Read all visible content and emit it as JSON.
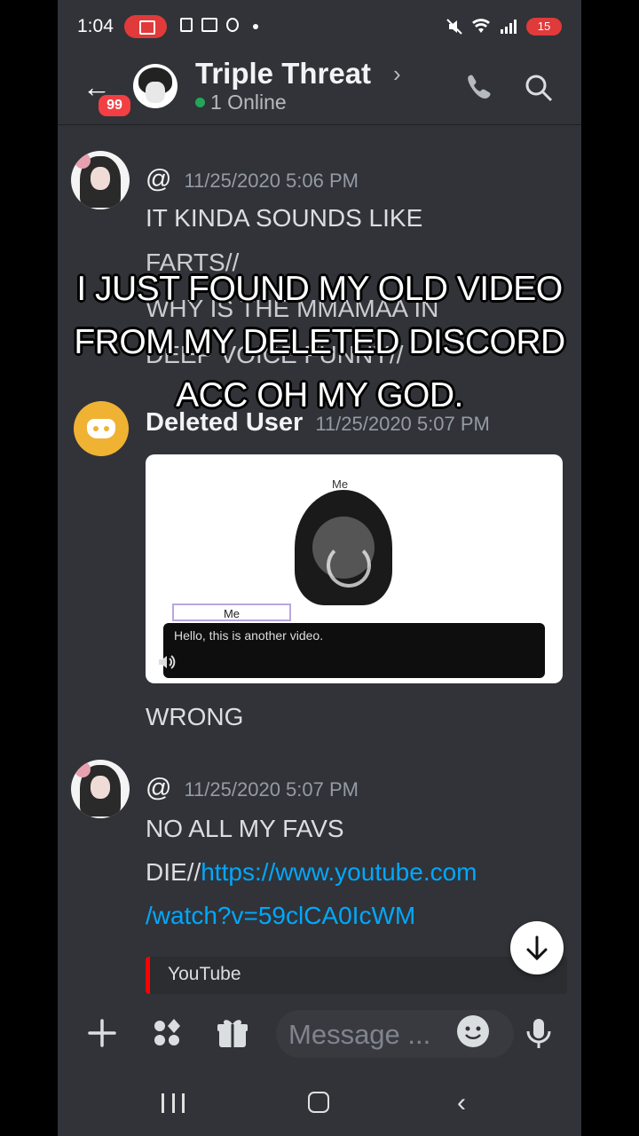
{
  "status_bar": {
    "time": "1:04",
    "battery": "15"
  },
  "header": {
    "title": "Triple Threat",
    "unread_badge": "99",
    "online_text": "1 Online"
  },
  "messages": [
    {
      "author": "@",
      "timestamp": "11/25/2020 5:06 PM",
      "lines": [
        "IT KINDA SOUNDS LIKE",
        "FARTS//",
        "WHY IS THE MMAMAA IN",
        "DEEP VOICE FUNNY//"
      ]
    },
    {
      "author": "Deleted User",
      "timestamp": "11/25/2020 5:07 PM",
      "video": {
        "top_label": "Me",
        "name_tag": "Me",
        "dialog": "Hello, this is another video."
      },
      "text_after": "WRONG"
    },
    {
      "author": "@",
      "timestamp": "11/25/2020 5:07 PM",
      "line1": "NO ALL MY FAVS",
      "line2_prefix": "DIE//",
      "link_part1": "https://www.youtube.com",
      "link_part2": "/watch?v=59clCA0IcWM",
      "embed_provider": "YouTube"
    }
  ],
  "input": {
    "placeholder": "Message ..."
  },
  "caption": {
    "line1": "I JUST FOUND MY OLD VIDEO",
    "line2": "FROM MY DELETED DISCORD",
    "line3": "ACC OH MY GOD."
  }
}
